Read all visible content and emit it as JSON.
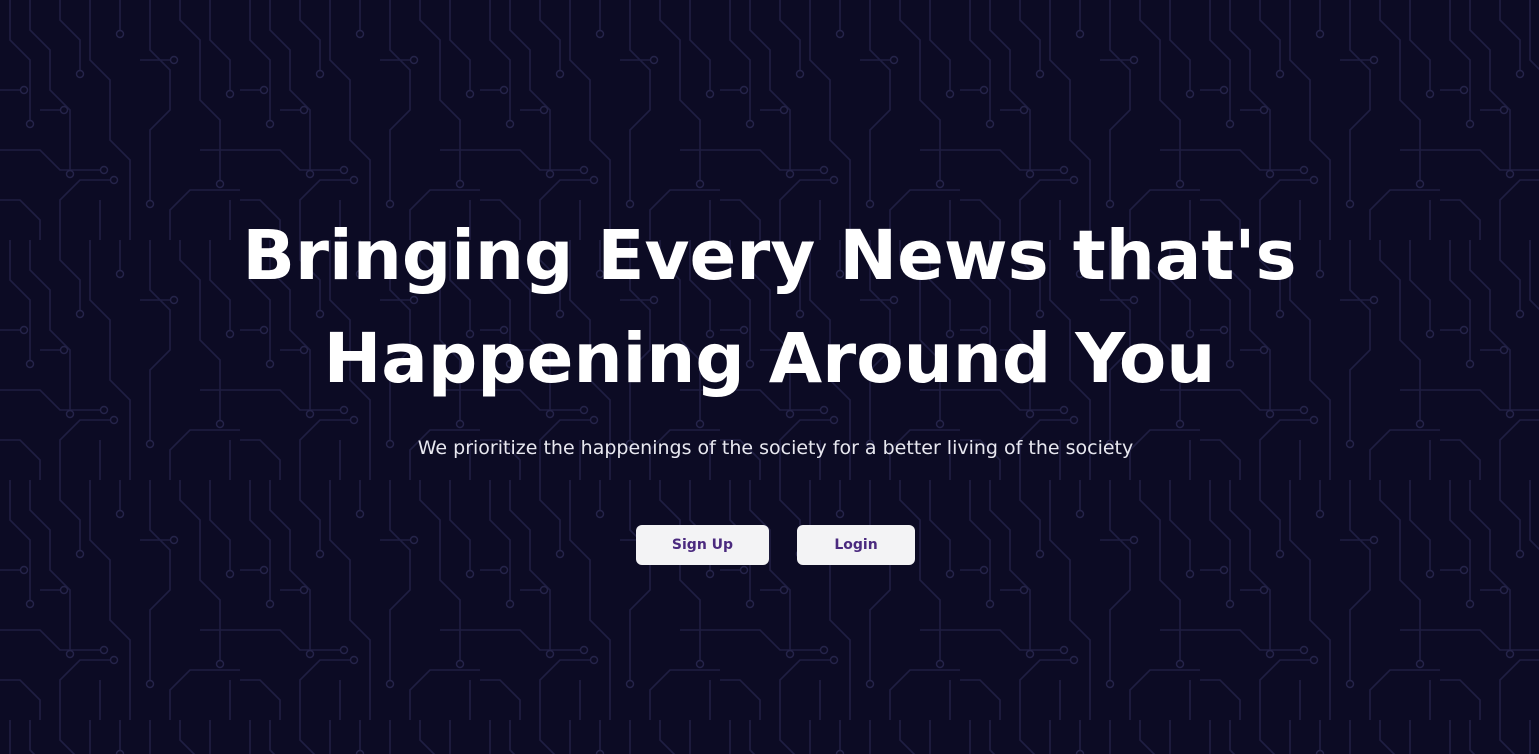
{
  "hero": {
    "headline_line1": "Bringing Every News that's",
    "headline_line2": "Happening Around You",
    "subtitle": "We prioritize the happenings of the society for a better living of the society"
  },
  "actions": {
    "signup_label": "Sign Up",
    "login_label": "Login"
  },
  "colors": {
    "background": "#0c0b24",
    "circuit_lines": "#1d1c3e",
    "headline_text": "#ffffff",
    "button_bg": "#f3f3f5",
    "button_text": "#4b2a7f"
  }
}
